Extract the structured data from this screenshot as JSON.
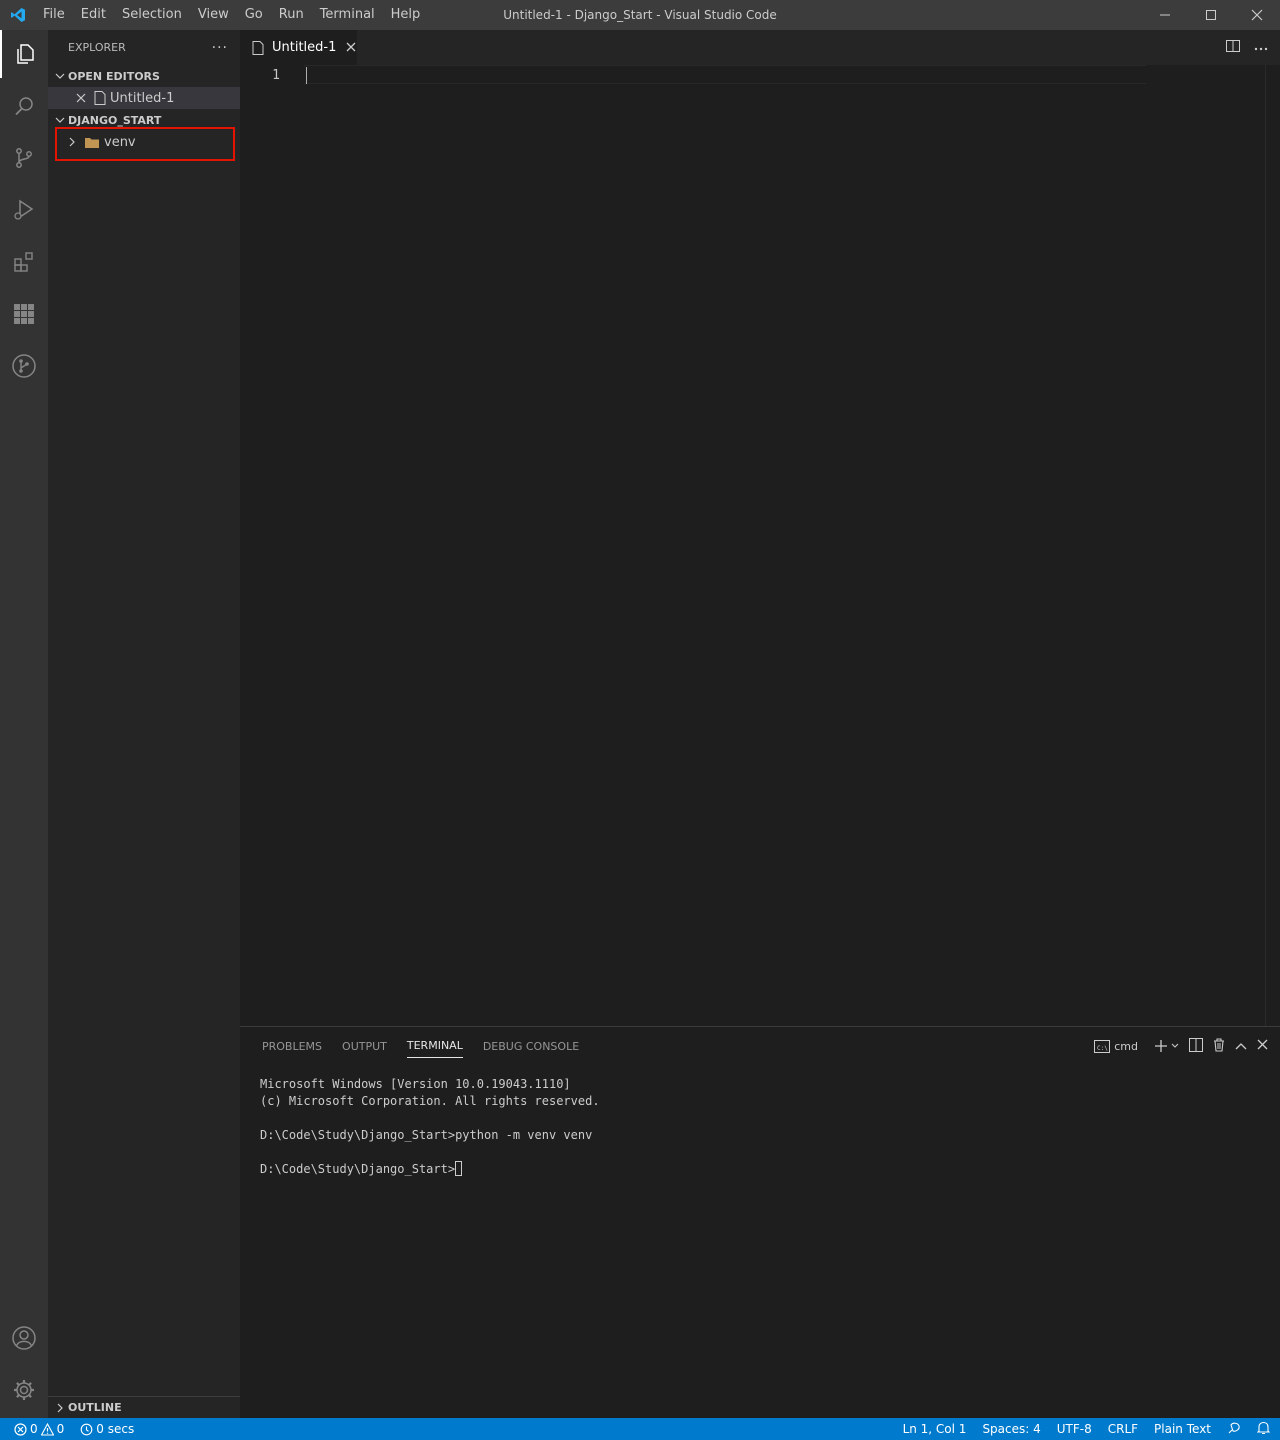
{
  "titlebar": {
    "menu": [
      "File",
      "Edit",
      "Selection",
      "View",
      "Go",
      "Run",
      "Terminal",
      "Help"
    ],
    "title": "Untitled-1 - Django_Start - Visual Studio Code"
  },
  "activitybar": {
    "items": [
      "explorer-icon",
      "search-icon",
      "source-control-icon",
      "run-debug-icon",
      "extensions-icon",
      "remote-explorer-icon",
      "gitlens-icon"
    ],
    "bottom": [
      "account-icon",
      "settings-gear-icon"
    ]
  },
  "sidebar": {
    "header": "EXPLORER",
    "more": "···",
    "open_editors": {
      "title": "OPEN EDITORS",
      "items": [
        {
          "name": "Untitled-1"
        }
      ]
    },
    "workspace": {
      "title": "DJANGO_START",
      "items": [
        {
          "name": "venv",
          "type": "folder"
        }
      ]
    },
    "outline": "OUTLINE"
  },
  "editor": {
    "tab_label": "Untitled-1",
    "line_number": "1"
  },
  "panel": {
    "tabs": [
      "PROBLEMS",
      "OUTPUT",
      "TERMINAL",
      "DEBUG CONSOLE"
    ],
    "active_tab": "TERMINAL",
    "shell": "cmd",
    "terminal_lines": [
      "Microsoft Windows [Version 10.0.19043.1110]",
      "(c) Microsoft Corporation. All rights reserved.",
      "",
      "D:\\Code\\Study\\Django_Start>python -m venv venv",
      "",
      "D:\\Code\\Study\\Django_Start>"
    ]
  },
  "statusbar": {
    "errors": "0",
    "warnings": "0",
    "timer": "0 secs",
    "position": "Ln 1, Col 1",
    "spaces": "Spaces: 4",
    "encoding": "UTF-8",
    "eol": "CRLF",
    "language": "Plain Text"
  },
  "colors": {
    "accent": "#007acc",
    "highlight_box": "#e51400",
    "folder": "#c09553"
  }
}
